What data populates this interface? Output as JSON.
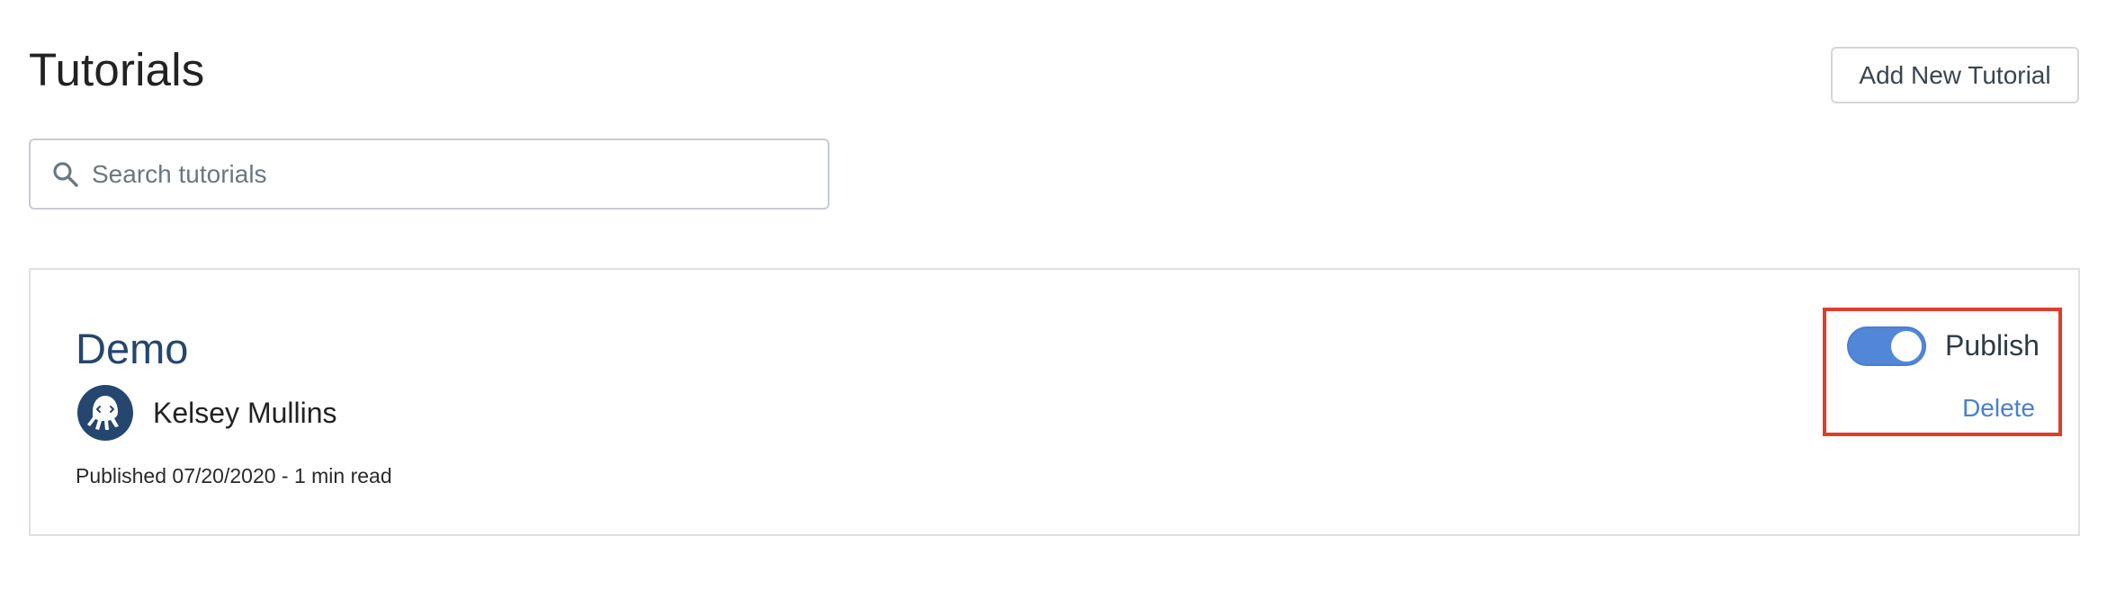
{
  "header": {
    "title": "Tutorials",
    "add_button_label": "Add New Tutorial"
  },
  "search": {
    "placeholder": "Search tutorials",
    "value": "",
    "icon": "search-icon"
  },
  "tutorials": [
    {
      "title": "Demo",
      "author": "Kelsey Mullins",
      "avatar_icon": "octopus-avatar-icon",
      "published_info": "Published 07/20/2020 - 1 min read",
      "publish_label": "Publish",
      "published": true,
      "delete_label": "Delete"
    }
  ],
  "colors": {
    "toggle_on": "#5287d7",
    "link": "#4a7fd0",
    "title_link": "#24466f",
    "highlight_border": "#e03d2a",
    "avatar_bg": "#24466f"
  }
}
